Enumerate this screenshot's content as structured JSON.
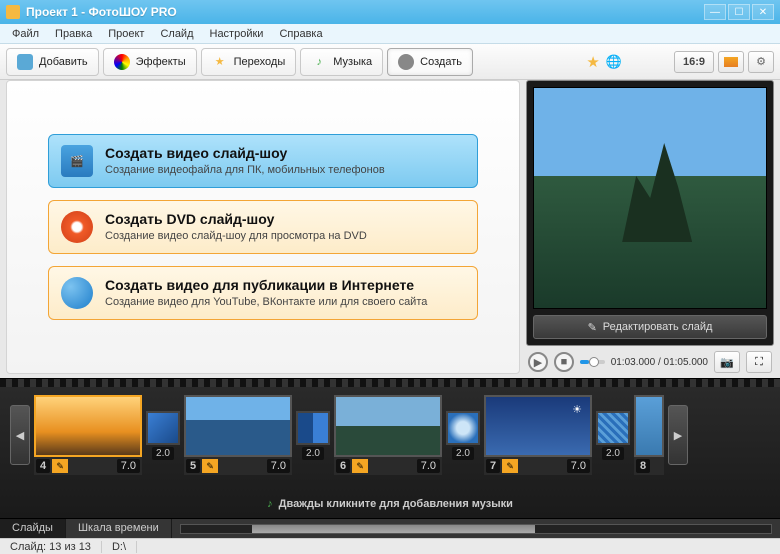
{
  "title": "Проект 1 - ФотоШОУ PRO",
  "menu": [
    "Файл",
    "Правка",
    "Проект",
    "Слайд",
    "Настройки",
    "Справка"
  ],
  "toolbar": {
    "add": "Добавить",
    "effects": "Эффекты",
    "transitions": "Переходы",
    "music": "Музыка",
    "create": "Создать",
    "ratio": "16:9"
  },
  "create_options": [
    {
      "title": "Создать видео слайд-шоу",
      "desc": "Создание видеофайла для ПК, мобильных телефонов",
      "primary": true
    },
    {
      "title": "Создать DVD слайд-шоу",
      "desc": "Создание видео слайд-шоу для просмотра на DVD",
      "primary": false
    },
    {
      "title": "Создать видео для публикации в Интернете",
      "desc": "Создание видео для YouTube, ВКонтакте или для своего сайта",
      "primary": false
    }
  ],
  "preview": {
    "edit_label": "Редактировать слайд",
    "timecode": "01:03.000 / 01:05.000"
  },
  "timeline": {
    "slides": [
      {
        "n": "4",
        "dur": "7.0",
        "selected": true
      },
      {
        "n": "5",
        "dur": "7.0",
        "selected": false
      },
      {
        "n": "6",
        "dur": "7.0",
        "selected": false
      },
      {
        "n": "7",
        "dur": "7.0",
        "selected": false
      },
      {
        "n": "8",
        "dur": "",
        "selected": false
      }
    ],
    "trans_dur": "2.0",
    "music_hint": "Дважды кликните для добавления музыки"
  },
  "bottom_tabs": {
    "slides": "Слайды",
    "timeline": "Шкала времени"
  },
  "status": {
    "count": "Слайд: 13 из 13",
    "path": "D:\\"
  }
}
